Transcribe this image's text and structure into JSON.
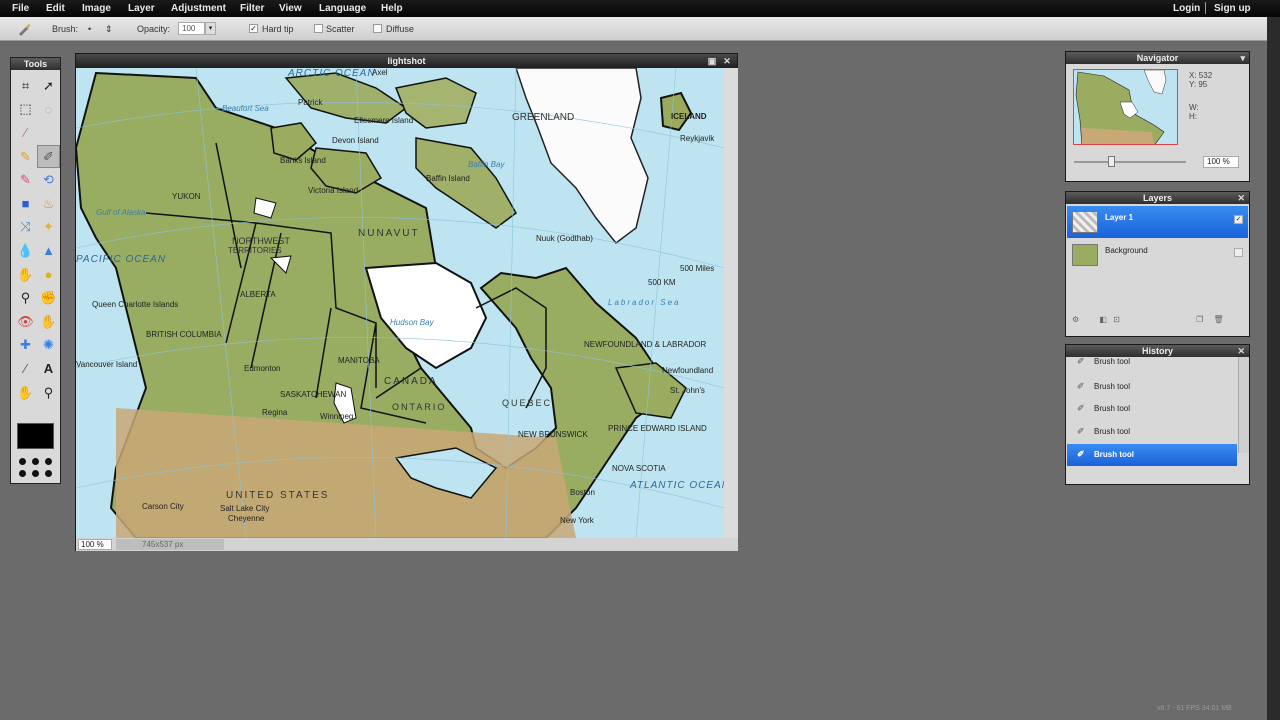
{
  "menubar": {
    "items": [
      "File",
      "Edit",
      "Image",
      "Layer",
      "Adjustment",
      "Filter",
      "View",
      "Language",
      "Help"
    ],
    "login": "Login",
    "signup": "Sign up"
  },
  "options": {
    "brush_label": "Brush:",
    "opacity_label": "Opacity:",
    "opacity_value": "100",
    "hard_tip": "Hard tip",
    "hard_tip_checked": "✓",
    "scatter": "Scatter",
    "diffuse": "Diffuse"
  },
  "tools": {
    "title": "Tools",
    "primary_color": "#000000"
  },
  "image_window": {
    "title": "lightshot",
    "zoom": "100",
    "zoom_unit": "%",
    "dimensions": "745x537 px"
  },
  "map_labels": {
    "arctic_ocean": "ARCTIC OCEAN",
    "greenland": "GREENLAND",
    "northwest": "NORTHWEST",
    "territories": "TERRITORIES",
    "nunavut": "NUNAVUT",
    "canada": "CANADA",
    "ontario": "ONTARIO",
    "quebec": "QUEBEC",
    "manitoba": "MANITOBA",
    "alberta": "ALBERTA",
    "british_columbia": "BRITISH COLUMBIA",
    "saskatchewan": "SASKATCHEWAN",
    "yukon": "YUKON",
    "united_states": "UNITED STATES",
    "pacific_ocean": "PACIFIC OCEAN",
    "atlantic_ocean": "ATLANTIC OCEAN",
    "hudson_bay": "Hudson Bay",
    "baffin_bay": "Baffin Bay",
    "beaufort_sea": "Beaufort Sea",
    "labrador_sea": "Labrador Sea",
    "gulf_of_alaska": "Gulf of Alaska",
    "nuuk": "Nuuk (Godthab)",
    "newfoundland": "Newfoundland",
    "nova_scotia": "NOVA SCOTIA",
    "new_brunswick": "NEW BRUNSWICK",
    "pei": "PRINCE EDWARD ISLAND",
    "labrador": "NEWFOUNDLAND & LABRADOR",
    "st_johns": "St. John's",
    "scale": "500 Miles",
    "scale_km": "500 KM",
    "queen_charlotte": "Queen Charlotte Islands",
    "vancouver_island": "Vancouver Island",
    "salt_lake_city": "Salt Lake City",
    "carson_city": "Carson City",
    "cheyenne": "Cheyenne",
    "new_york": "New York",
    "boston": "Boston",
    "patrick": "Patrick",
    "axel": "Axel",
    "ellesmere": "Ellesmere Island",
    "devon": "Devon Island",
    "baffin": "Baffin Island",
    "victoria": "Victoria Island",
    "banks": "Banks Island",
    "regina": "Regina",
    "winnipeg": "Winnipeg",
    "edmonton": "Edmonton",
    "iceland": "ICELAND",
    "reykjavik": "Reykjavik"
  },
  "navigator": {
    "title": "Navigator",
    "x_label": "X:",
    "x_value": "532",
    "y_label": "Y:",
    "y_value": "95",
    "w_label": "W:",
    "h_label": "H:",
    "zoom": "100",
    "zoom_unit": "%"
  },
  "layers": {
    "title": "Layers",
    "items": [
      {
        "name": "Layer 1",
        "selected": true
      },
      {
        "name": "Background",
        "selected": false
      }
    ]
  },
  "history": {
    "title": "History",
    "items": [
      "Brush tool",
      "Brush tool",
      "Brush tool",
      "Brush tool",
      "Brush tool"
    ]
  },
  "version": "v8.7 - 61 FPS 34.01 MB"
}
